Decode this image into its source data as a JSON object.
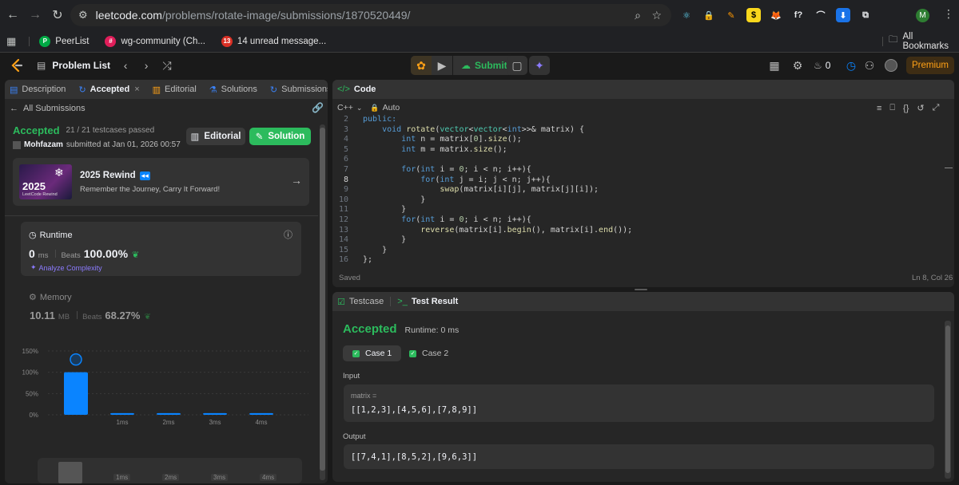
{
  "browser": {
    "url_host": "leetcode.com",
    "url_path": "/problems/rotate-image/submissions/1870520449/",
    "profile_initial": "M",
    "extensions": [
      {
        "name": "react-icon",
        "glyph": "⚛",
        "color": "#61dafb",
        "bg": "transparent"
      },
      {
        "name": "lock-icon",
        "glyph": "🔒",
        "color": "#e53935",
        "bg": "transparent"
      },
      {
        "name": "pen-icon",
        "glyph": "✎",
        "color": "#ff9800",
        "bg": "transparent"
      },
      {
        "name": "dollar-icon",
        "glyph": "$",
        "color": "#000",
        "bg": "#f9d71c"
      },
      {
        "name": "fox-icon",
        "glyph": "🦊",
        "color": "#ff6d00",
        "bg": "transparent"
      },
      {
        "name": "function-icon",
        "glyph": "f?",
        "color": "#e8eaed",
        "bg": "transparent"
      },
      {
        "name": "hook-icon",
        "glyph": "⌒",
        "color": "#e8eaed",
        "bg": "transparent"
      },
      {
        "name": "download-icon",
        "glyph": "⬇",
        "color": "#fff",
        "bg": "#1a73e8"
      },
      {
        "name": "puzzle-icon",
        "glyph": "⧉",
        "color": "#e8eaed",
        "bg": "transparent"
      }
    ],
    "bookmarks": [
      {
        "label": "PeerList",
        "fav": "P",
        "color": "#00aa45"
      },
      {
        "label": "wg-community (Ch...",
        "fav": "#",
        "color": "#e01e5a"
      },
      {
        "label": "14 unread message...",
        "fav": "13",
        "color": "#d93025"
      }
    ],
    "all_bookmarks": "All Bookmarks"
  },
  "nav": {
    "problem_list": "Problem List",
    "submit": "Submit",
    "streak": "0",
    "premium": "Premium"
  },
  "left": {
    "tabs": [
      {
        "label": "Description",
        "icon": "▤",
        "color": "#3b82f6"
      },
      {
        "label": "Accepted",
        "icon": "↻",
        "color": "#3b82f6",
        "active": true,
        "close": "×"
      },
      {
        "label": "Editorial",
        "icon": "▥",
        "color": "#ffa116"
      },
      {
        "label": "Solutions",
        "icon": "⚗",
        "color": "#3b82f6"
      },
      {
        "label": "Submissions",
        "icon": "↻",
        "color": "#3b82f6"
      }
    ],
    "all_submissions": "All Submissions",
    "status": "Accepted",
    "testcases": "21 / 21 testcases passed",
    "user": "Mohfazam",
    "submitted_at": "submitted at Jan 01, 2026 00:57",
    "editorial_btn": "Editorial",
    "solution_btn": "Solution",
    "rewind": {
      "year": "2025",
      "caption": "LeetCode Rewind",
      "title": "2025 Rewind",
      "subtitle": "Remember the Journey, Carry It Forward!"
    },
    "runtime": {
      "label": "Runtime",
      "value": "0",
      "unit": "ms",
      "beats_label": "Beats",
      "beats": "100.00%",
      "analyze": "Analyze Complexity"
    },
    "memory": {
      "label": "Memory",
      "value": "10.11",
      "unit": "MB",
      "beats_label": "Beats",
      "beats": "68.27%"
    }
  },
  "chart_data": {
    "type": "bar",
    "yticks": [
      "150%",
      "100%",
      "50%",
      "0%"
    ],
    "ylim": [
      0,
      150
    ],
    "categories": [
      "",
      "1ms",
      "2ms",
      "3ms",
      "4ms"
    ],
    "values": [
      100,
      4,
      4,
      4,
      4
    ],
    "accent": "#0a84ff",
    "mini_labels": [
      "1ms",
      "2ms",
      "3ms",
      "4ms"
    ]
  },
  "code": {
    "title": "Code",
    "language": "C++",
    "mode": "Auto",
    "lines": [
      {
        "n": "2",
        "tokens": [
          {
            "t": "public:",
            "c": "kw"
          }
        ]
      },
      {
        "n": "3",
        "tokens": [
          {
            "t": "    ",
            "c": "pl"
          },
          {
            "t": "void ",
            "c": "kw"
          },
          {
            "t": "rotate",
            "c": "fn"
          },
          {
            "t": "(",
            "c": "pl"
          },
          {
            "t": "vector",
            "c": "ty"
          },
          {
            "t": "<",
            "c": "pl"
          },
          {
            "t": "vector",
            "c": "ty"
          },
          {
            "t": "<",
            "c": "pl"
          },
          {
            "t": "int",
            "c": "kw"
          },
          {
            "t": ">>& matrix) {",
            "c": "pl"
          }
        ]
      },
      {
        "n": "4",
        "tokens": [
          {
            "t": "        ",
            "c": "pl"
          },
          {
            "t": "int ",
            "c": "kw"
          },
          {
            "t": "n = matrix[",
            "c": "pl"
          },
          {
            "t": "0",
            "c": "num"
          },
          {
            "t": "].",
            "c": "pl"
          },
          {
            "t": "size",
            "c": "fn"
          },
          {
            "t": "();",
            "c": "pl"
          }
        ]
      },
      {
        "n": "5",
        "tokens": [
          {
            "t": "        ",
            "c": "pl"
          },
          {
            "t": "int ",
            "c": "kw"
          },
          {
            "t": "m = matrix.",
            "c": "pl"
          },
          {
            "t": "size",
            "c": "fn"
          },
          {
            "t": "();",
            "c": "pl"
          }
        ]
      },
      {
        "n": "6",
        "tokens": []
      },
      {
        "n": "7",
        "tokens": [
          {
            "t": "        ",
            "c": "pl"
          },
          {
            "t": "for",
            "c": "kw"
          },
          {
            "t": "(",
            "c": "pl"
          },
          {
            "t": "int ",
            "c": "kw"
          },
          {
            "t": "i = ",
            "c": "pl"
          },
          {
            "t": "0",
            "c": "num"
          },
          {
            "t": "; i < n; i++){",
            "c": "pl"
          }
        ]
      },
      {
        "n": "8",
        "tokens": [
          {
            "t": "            ",
            "c": "pl"
          },
          {
            "t": "for",
            "c": "kw"
          },
          {
            "t": "(",
            "c": "pl"
          },
          {
            "t": "int ",
            "c": "kw"
          },
          {
            "t": "j = i; j < n; j++){",
            "c": "pl"
          }
        ]
      },
      {
        "n": "9",
        "tokens": [
          {
            "t": "                ",
            "c": "pl"
          },
          {
            "t": "swap",
            "c": "fn"
          },
          {
            "t": "(matrix[i][j], matrix[j][i]);",
            "c": "pl"
          }
        ]
      },
      {
        "n": "10",
        "tokens": [
          {
            "t": "            }",
            "c": "pl"
          }
        ]
      },
      {
        "n": "11",
        "tokens": [
          {
            "t": "        }",
            "c": "pl"
          }
        ]
      },
      {
        "n": "12",
        "tokens": [
          {
            "t": "        ",
            "c": "pl"
          },
          {
            "t": "for",
            "c": "kw"
          },
          {
            "t": "(",
            "c": "pl"
          },
          {
            "t": "int ",
            "c": "kw"
          },
          {
            "t": "i = ",
            "c": "pl"
          },
          {
            "t": "0",
            "c": "num"
          },
          {
            "t": "; i < n; i++){",
            "c": "pl"
          }
        ]
      },
      {
        "n": "13",
        "tokens": [
          {
            "t": "            ",
            "c": "pl"
          },
          {
            "t": "reverse",
            "c": "fn"
          },
          {
            "t": "(matrix[i].",
            "c": "pl"
          },
          {
            "t": "begin",
            "c": "fn"
          },
          {
            "t": "(), matrix[i].",
            "c": "pl"
          },
          {
            "t": "end",
            "c": "fn"
          },
          {
            "t": "());",
            "c": "pl"
          }
        ]
      },
      {
        "n": "14",
        "tokens": [
          {
            "t": "        }",
            "c": "pl"
          }
        ]
      },
      {
        "n": "15",
        "tokens": [
          {
            "t": "    }",
            "c": "pl"
          }
        ]
      },
      {
        "n": "16",
        "tokens": [
          {
            "t": "};",
            "c": "pl"
          }
        ]
      }
    ],
    "saved": "Saved",
    "cursor": "Ln 8, Col 26"
  },
  "result": {
    "tab_testcase": "Testcase",
    "tab_result": "Test Result",
    "status": "Accepted",
    "runtime": "Runtime: 0 ms",
    "case1": "Case 1",
    "case2": "Case 2",
    "input_label": "Input",
    "var_name": "matrix =",
    "input_value": "[[1,2,3],[4,5,6],[7,8,9]]",
    "output_label": "Output",
    "output_value": "[[7,4,1],[8,5,2],[9,6,3]]"
  }
}
